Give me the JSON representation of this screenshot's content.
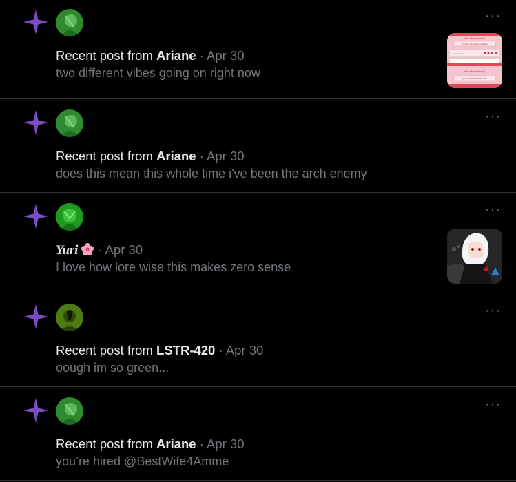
{
  "notifications": [
    {
      "prefix": "Recent post from ",
      "author": "Ariane",
      "separator": "·",
      "date": "Apr 30",
      "text": "two different vibes going on right now",
      "avatar_color": "#2f8a2f",
      "has_thumbnail": true,
      "thumbnail": {
        "kind": "screenshot",
        "lines": [
          "Ask me something!",
          "long live the green revolution",
          "4 hours ago",
          "Ask me something!",
          "get this parasite outta here"
        ]
      }
    },
    {
      "prefix": "Recent post from ",
      "author": "Ariane",
      "separator": "·",
      "date": "Apr 30",
      "text": "does this mean this whole time i've been the arch enemy",
      "avatar_color": "#2f8a2f",
      "has_thumbnail": false
    },
    {
      "prefix": "",
      "author": "Yuri",
      "author_emoji": "hibiscus-icon",
      "separator": "·",
      "date": "Apr 30",
      "text": "I love how lore wise this makes zero sense",
      "avatar_color": "#1e9b1e",
      "has_thumbnail": true,
      "thumbnail": {
        "kind": "anime-character"
      }
    },
    {
      "prefix": "Recent post from ",
      "author": "LSTR-420",
      "separator": "·",
      "date": "Apr 30",
      "text": "oough im so green...",
      "avatar_color": "#4e7a12",
      "has_thumbnail": false
    },
    {
      "prefix": "Recent post from ",
      "author": "Ariane",
      "separator": "·",
      "date": "Apr 30",
      "text": "you’re hired @BestWife4Amme",
      "avatar_color": "#2f8a2f",
      "has_thumbnail": false
    }
  ],
  "icons": {
    "notification_type": "sparkle-icon",
    "menu": "more-options-icon"
  },
  "colors": {
    "sparkle": "#794bc4",
    "muted": "#71767b",
    "text": "#e7e9ea",
    "divider": "#2f3336"
  }
}
